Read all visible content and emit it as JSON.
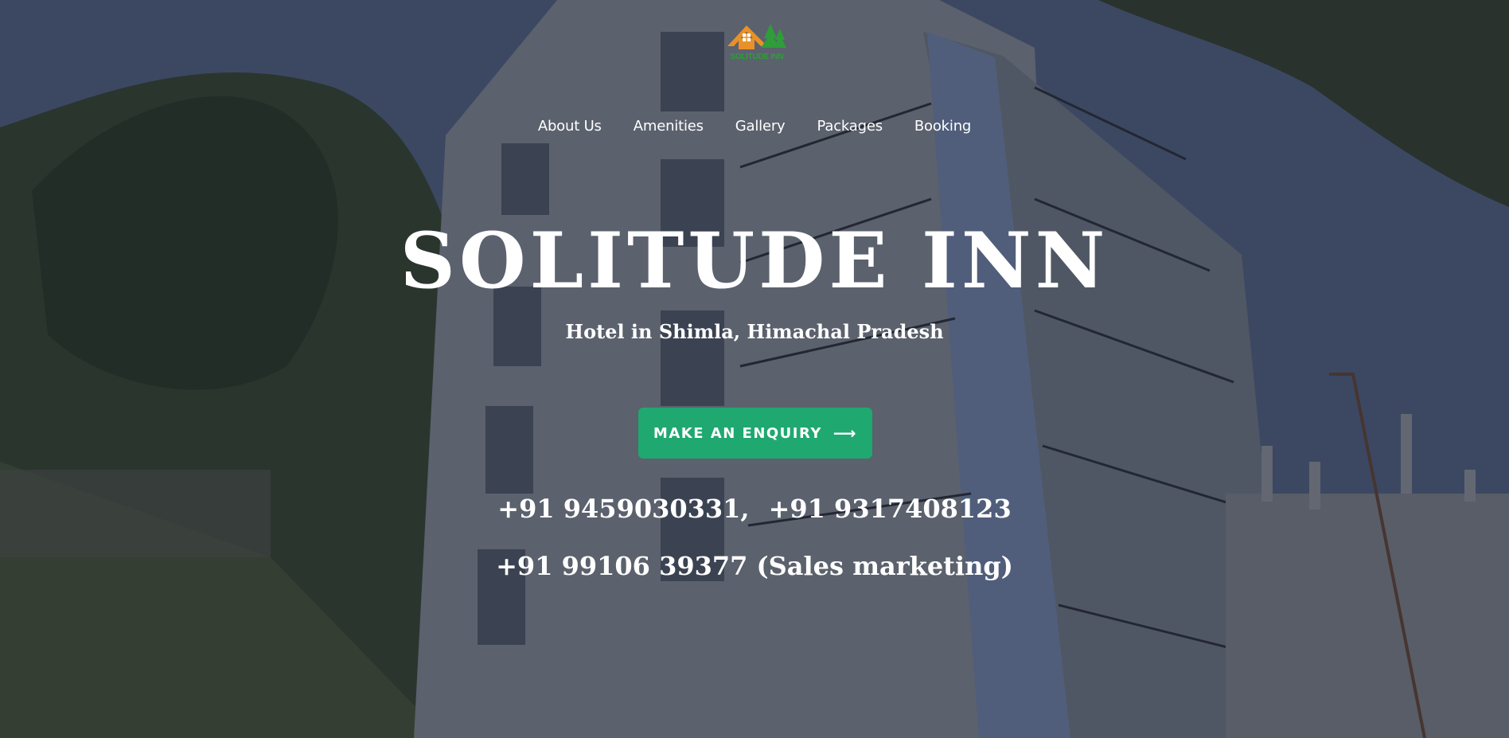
{
  "brand": {
    "logo_text": "SOLITUDE INN"
  },
  "nav": {
    "items": [
      {
        "label": "About Us"
      },
      {
        "label": "Amenities"
      },
      {
        "label": "Gallery"
      },
      {
        "label": "Packages"
      },
      {
        "label": "Booking"
      }
    ]
  },
  "hero": {
    "title": "SOLITUDE INN",
    "subtitle": "Hotel in Shimla, Himachal Pradesh",
    "cta_label": "MAKE AN ENQUIRY",
    "cta_icon": "arrow-right-icon"
  },
  "contact": {
    "phone_1": "+91 9459030331,",
    "phone_2": "+91 9317408123",
    "phone_3": "+91 99106 39377 (Sales marketing)"
  },
  "colors": {
    "accent": "#1fa870",
    "logo_orange": "#e8912a",
    "logo_green": "#2f9d3a",
    "text": "#ffffff"
  }
}
